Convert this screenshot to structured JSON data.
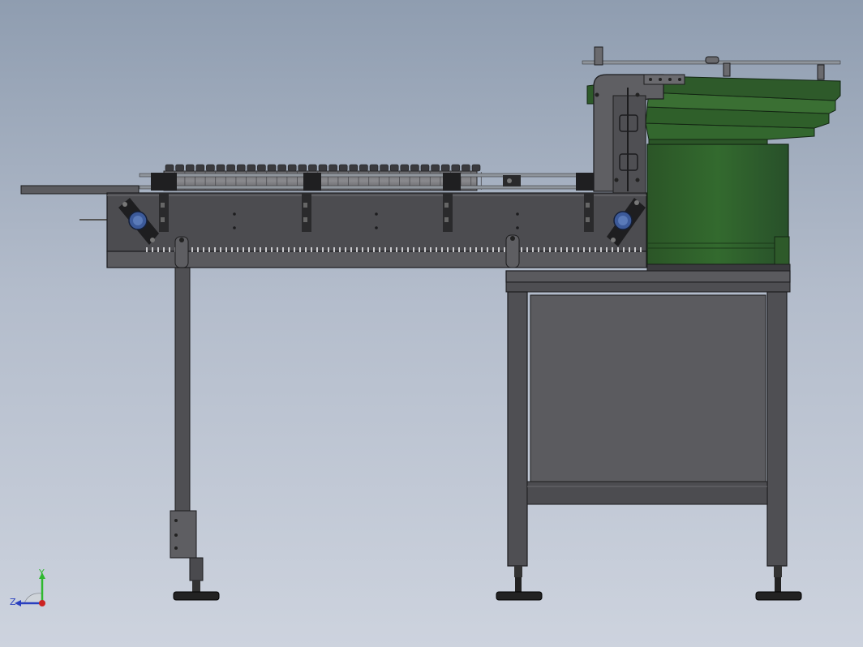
{
  "view": {
    "background_top": "#8f9db0",
    "background_bottom": "#cdd3de"
  },
  "colors": {
    "frame_dark": "#4b4b4f",
    "frame_mid": "#5a5a5e",
    "frame_light": "#6e6e72",
    "edge": "#1c1c1e",
    "bowl_green": "#2e5a2a",
    "bowl_green_light": "#3c7236",
    "bowl_green_dark": "#22441f",
    "bearing_blue": "#3c5a9a",
    "rail_steel": "#9aa0a8",
    "foot_black": "#222222"
  },
  "triad": {
    "y_label": "Y",
    "z_label": "Z",
    "y_color": "#2fb82f",
    "z_color": "#2a3fbf",
    "x_color": "#cc2222"
  }
}
